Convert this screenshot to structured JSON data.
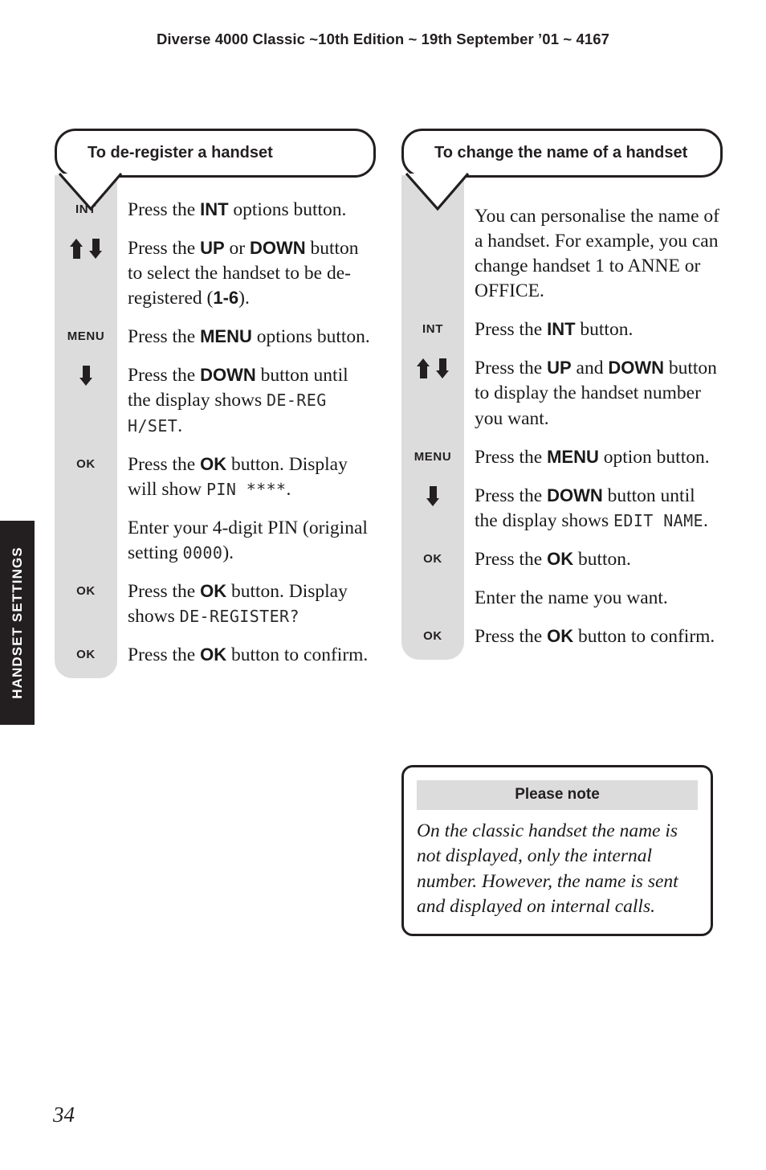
{
  "running_head": "Diverse 4000 Classic ~10th Edition ~ 19th September ’01 ~ 4167",
  "side_tab": {
    "label": "HANDSET SETTINGS"
  },
  "folio": "34",
  "colors": {
    "gray": "#dcdcdc",
    "ink": "#231f20",
    "tab_bg": "#231f20",
    "tab_text": "#ffffff"
  },
  "left_column": {
    "title": "To de-register a handset",
    "steps": [
      {
        "key": "INT",
        "key_type": "text",
        "parts": [
          {
            "t": "Press the "
          },
          {
            "t": "INT",
            "style": "bold"
          },
          {
            "t": " options button."
          }
        ]
      },
      {
        "key": "",
        "key_type": "updown",
        "parts": [
          {
            "t": "Press the "
          },
          {
            "t": "UP",
            "style": "bold"
          },
          {
            "t": " or "
          },
          {
            "t": "DOWN",
            "style": "bold"
          },
          {
            "t": " button to select the handset to be de-registered ("
          },
          {
            "t": "1-6",
            "style": "bold"
          },
          {
            "t": ")."
          }
        ]
      },
      {
        "key": "MENU",
        "key_type": "text",
        "parts": [
          {
            "t": "Press the "
          },
          {
            "t": "MENU",
            "style": "bold"
          },
          {
            "t": " options button."
          }
        ]
      },
      {
        "key": "",
        "key_type": "down",
        "parts": [
          {
            "t": "Press the "
          },
          {
            "t": "DOWN",
            "style": "bold"
          },
          {
            "t": " button until the display shows "
          },
          {
            "t": "DE-REG H/SET",
            "style": "lcd"
          },
          {
            "t": "."
          }
        ]
      },
      {
        "key": "OK",
        "key_type": "text",
        "parts": [
          {
            "t": "Press the "
          },
          {
            "t": "OK",
            "style": "bold"
          },
          {
            "t": " button. Display will show "
          },
          {
            "t": "PIN ****",
            "style": "lcd"
          },
          {
            "t": "."
          }
        ]
      },
      {
        "key": "",
        "key_type": "none",
        "parts": [
          {
            "t": "Enter your 4-digit PIN (original setting "
          },
          {
            "t": "0000",
            "style": "lcd"
          },
          {
            "t": ")."
          }
        ]
      },
      {
        "key": "OK",
        "key_type": "text",
        "parts": [
          {
            "t": "Press the "
          },
          {
            "t": "OK",
            "style": "bold"
          },
          {
            "t": " button. Display shows "
          },
          {
            "t": "DE-REGISTER?",
            "style": "lcd"
          }
        ]
      },
      {
        "key": "OK",
        "key_type": "text",
        "parts": [
          {
            "t": "Press the "
          },
          {
            "t": "OK",
            "style": "bold"
          },
          {
            "t": " button to confirm."
          }
        ]
      }
    ]
  },
  "right_column": {
    "title": "To change the name of a handset",
    "steps": [
      {
        "key": "",
        "key_type": "none",
        "parts": [
          {
            "t": "You can personalise the name of a handset. For example, you can change handset 1 to ANNE or OFFICE."
          }
        ]
      },
      {
        "key": "INT",
        "key_type": "text",
        "parts": [
          {
            "t": "Press the "
          },
          {
            "t": "INT",
            "style": "bold"
          },
          {
            "t": " button."
          }
        ]
      },
      {
        "key": "",
        "key_type": "updown",
        "parts": [
          {
            "t": "Press the "
          },
          {
            "t": "UP",
            "style": "bold"
          },
          {
            "t": " and "
          },
          {
            "t": "DOWN",
            "style": "bold"
          },
          {
            "t": " button to display the handset number you want."
          }
        ]
      },
      {
        "key": "MENU",
        "key_type": "text",
        "parts": [
          {
            "t": "Press the "
          },
          {
            "t": "MENU",
            "style": "bold"
          },
          {
            "t": " option button."
          }
        ]
      },
      {
        "key": "",
        "key_type": "down",
        "parts": [
          {
            "t": "Press the "
          },
          {
            "t": "DOWN",
            "style": "bold"
          },
          {
            "t": " button until the display shows "
          },
          {
            "t": "EDIT NAME",
            "style": "lcd"
          },
          {
            "t": "."
          }
        ]
      },
      {
        "key": "OK",
        "key_type": "text",
        "parts": [
          {
            "t": "Press the "
          },
          {
            "t": "OK",
            "style": "bold"
          },
          {
            "t": " button."
          }
        ]
      },
      {
        "key": "",
        "key_type": "none",
        "parts": [
          {
            "t": "Enter the name you want."
          }
        ]
      },
      {
        "key": "OK",
        "key_type": "text",
        "parts": [
          {
            "t": "Press the "
          },
          {
            "t": "OK",
            "style": "bold"
          },
          {
            "t": " button to confirm."
          }
        ]
      }
    ]
  },
  "note": {
    "heading": "Please note",
    "body": "On the classic handset the name is not displayed, only the internal number. However, the name is sent and displayed on internal calls."
  }
}
